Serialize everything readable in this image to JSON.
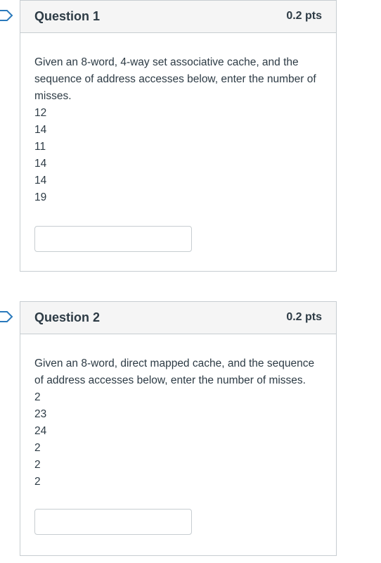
{
  "questions": [
    {
      "title": "Question 1",
      "points": "0.2 pts",
      "prompt": "Given an 8-word, 4-way set associative cache, and the sequence of address accesses below, enter the number of misses.",
      "sequence": [
        "12",
        "14",
        "11",
        "14",
        "14",
        "19"
      ],
      "answer_value": ""
    },
    {
      "title": "Question 2",
      "points": "0.2 pts",
      "prompt": "Given an 8-word, direct mapped cache, and the sequence of address accesses below, enter the number of misses.",
      "sequence": [
        "2",
        "23",
        "24",
        "2",
        "2",
        "2"
      ],
      "answer_value": ""
    }
  ],
  "icons": {
    "flag": "bookmark-flag-icon"
  },
  "colors": {
    "border": "#c7cdd1",
    "header_bg": "#f5f5f5",
    "text": "#2d3b45",
    "flag": "#2b7abc"
  }
}
